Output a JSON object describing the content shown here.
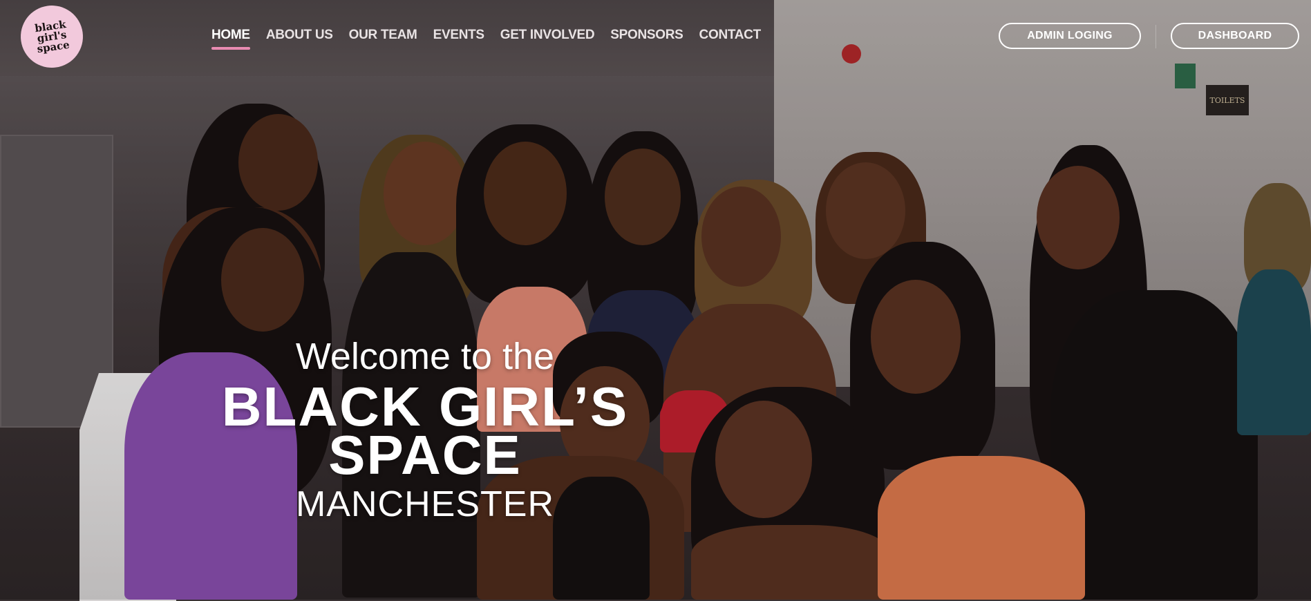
{
  "logo": {
    "lines": [
      "black",
      "girl's",
      "space"
    ]
  },
  "nav": {
    "items": [
      {
        "label": "HOME",
        "active": true
      },
      {
        "label": "ABOUT US"
      },
      {
        "label": "OUR TEAM"
      },
      {
        "label": "EVENTS"
      },
      {
        "label": "GET INVOLVED"
      },
      {
        "label": "SPONSORS"
      },
      {
        "label": "CONTACT"
      }
    ],
    "admin_label": "ADMIN LOGING",
    "dashboard_label": "DASHBOARD"
  },
  "hero": {
    "welcome": "Welcome to the",
    "brand_line1": "BLACK GIRL’S",
    "brand_line2": "SPACE",
    "city": "MANCHESTER"
  },
  "background": {
    "sign": "TOILETS"
  },
  "colors": {
    "accent": "#e88bb2",
    "logo_bg": "#f2c9dc"
  }
}
